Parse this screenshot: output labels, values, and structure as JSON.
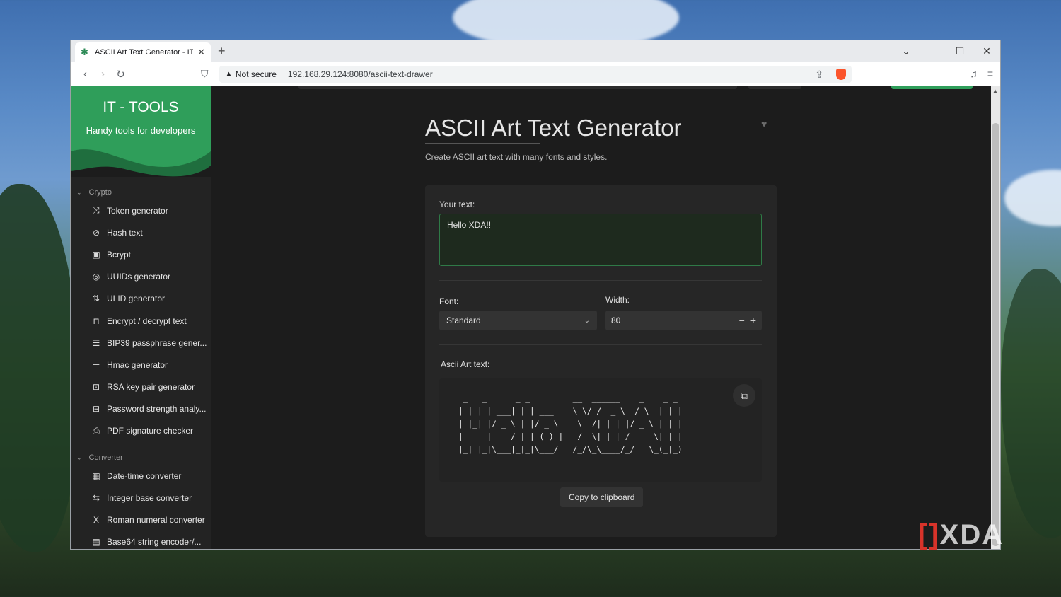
{
  "browser": {
    "tab_title": "ASCII Art Text Generator - IT To",
    "security_label": "Not secure",
    "url": "192.168.29.124:8080/ascii-text-drawer"
  },
  "sidebar": {
    "title": "IT - TOOLS",
    "subtitle": "Handy tools for developers",
    "groups": [
      {
        "label": "Crypto",
        "items": [
          {
            "label": "Token generator",
            "icon": "shuffle-icon"
          },
          {
            "label": "Hash text",
            "icon": "eye-off-icon"
          },
          {
            "label": "Bcrypt",
            "icon": "lock-square-icon"
          },
          {
            "label": "UUIDs generator",
            "icon": "fingerprint-icon"
          },
          {
            "label": "ULID generator",
            "icon": "sort-numeric-icon"
          },
          {
            "label": "Encrypt / decrypt text",
            "icon": "lock-icon"
          },
          {
            "label": "BIP39 passphrase gener...",
            "icon": "align-justified-icon"
          },
          {
            "label": "Hmac generator",
            "icon": "short-text-icon"
          },
          {
            "label": "RSA key pair generator",
            "icon": "certificate-icon"
          },
          {
            "label": "Password strength analy...",
            "icon": "password-icon"
          },
          {
            "label": "PDF signature checker",
            "icon": "file-certificate-icon"
          }
        ]
      },
      {
        "label": "Converter",
        "items": [
          {
            "label": "Date-time converter",
            "icon": "calendar-icon"
          },
          {
            "label": "Integer base converter",
            "icon": "arrows-left-right-icon"
          },
          {
            "label": "Roman numeral converter",
            "icon": "letter-x-icon"
          },
          {
            "label": "Base64 string encoder/...",
            "icon": "file-digit-icon"
          }
        ]
      }
    ]
  },
  "main": {
    "title": "ASCII Art Text Generator",
    "description": "Create ASCII art text with many fonts and styles.",
    "text_label": "Your text:",
    "text_value": "Hello XDA!!",
    "font_label": "Font:",
    "font_value": "Standard",
    "width_label": "Width:",
    "width_value": "80",
    "ascii_label": "Ascii Art text:",
    "ascii_output": " _   _      _ _         __  ______    _    _ _ \n| | | | ___| | | ___    \\ \\/ /  _ \\  / \\  | | |\n| |_| |/ _ \\ | |/ _ \\    \\  /| | | |/ _ \\ | | |\n|  _  |  __/ | | (_) |   /  \\| |_| / ___ \\|_|_|\n|_| |_|\\___|_|_|\\___/   /_/\\_\\____/_/   \\_(_|_)",
    "copy_button": "Copy to clipboard"
  },
  "watermark": "XDA"
}
